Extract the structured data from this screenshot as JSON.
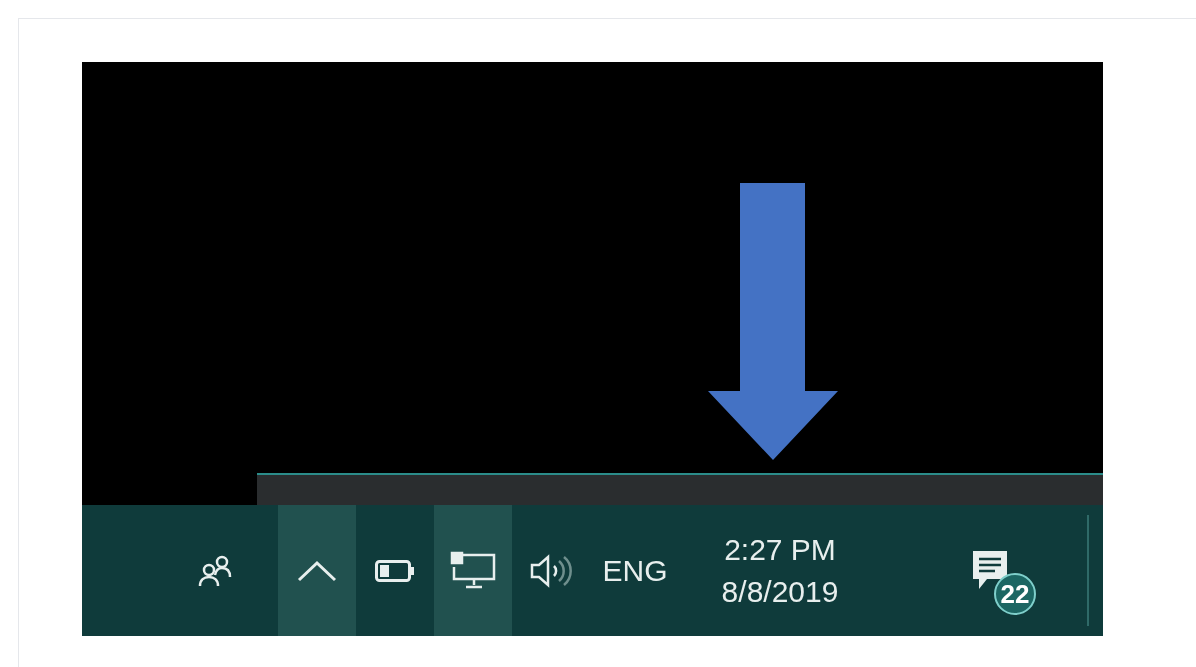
{
  "taskbar": {
    "tray_icons": [
      {
        "kind": "chevron",
        "highlighted": true
      },
      {
        "kind": "battery",
        "highlighted": false
      },
      {
        "kind": "network",
        "highlighted": true
      },
      {
        "kind": "volume",
        "highlighted": false
      }
    ],
    "language": "ENG",
    "time": "2:27 PM",
    "date": "8/8/2019",
    "notification_count": "22"
  }
}
